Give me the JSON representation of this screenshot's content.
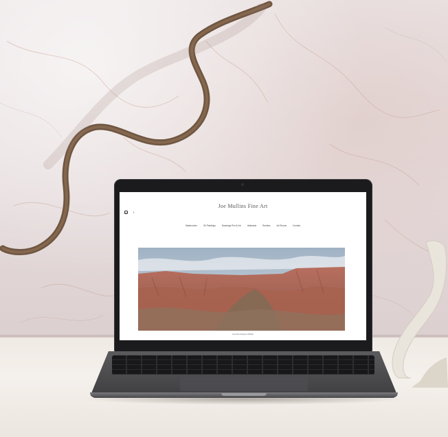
{
  "website": {
    "title": "Joe Mullins Fine Art",
    "social_icons": [
      "instagram-icon",
      "facebook-icon"
    ],
    "social_glyphs": {
      "instagram": "◘",
      "facebook": "f"
    },
    "nav": [
      "Watercolors",
      "Oil Paintings",
      "Drawings Pen & Ink",
      "Abstracts",
      "Rockies",
      "Art Shows",
      "Contact"
    ],
    "hero_caption": "Into the Canyon 20x32"
  },
  "colors": {
    "screen_bg": "#ffffff",
    "laptop_body": "#1b1b1d",
    "wall": "#e6dcdd",
    "table": "#f4f0eb"
  }
}
